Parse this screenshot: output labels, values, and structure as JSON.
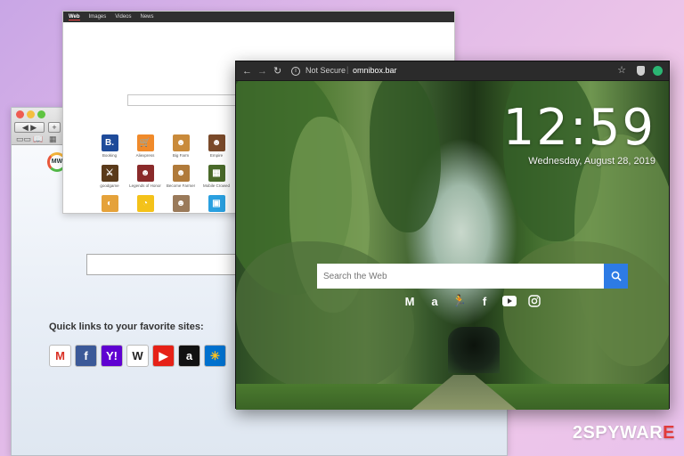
{
  "background_window_top": {
    "tabs": [
      "Web",
      "Images",
      "Videos",
      "News"
    ],
    "apps": [
      {
        "label": "Booking",
        "color": "#1e4b9a",
        "glyph": "B."
      },
      {
        "label": "Aliexpress",
        "color": "#f08a2a",
        "glyph": "🛒"
      },
      {
        "label": "Big Farm",
        "color": "#c98a3a",
        "glyph": "☻"
      },
      {
        "label": "Empire",
        "color": "#7a4a2a",
        "glyph": "☻"
      },
      {
        "label": "goodgame",
        "color": "#5a3a1a",
        "glyph": "⚔"
      },
      {
        "label": "Legends of Honor",
        "color": "#8a2a2a",
        "glyph": "☻"
      },
      {
        "label": "Become Farmer",
        "color": "#b07a3a",
        "glyph": "☻"
      },
      {
        "label": "Mobile Crowed",
        "color": "#4a6a2a",
        "glyph": "▦"
      },
      {
        "label": "",
        "color": "#e5a23a",
        "glyph": "◐"
      },
      {
        "label": "",
        "color": "#f4c21a",
        "glyph": "◔"
      },
      {
        "label": "",
        "color": "#9a7a5a",
        "glyph": "☻"
      },
      {
        "label": "",
        "color": "#2aa0e0",
        "glyph": "▣"
      }
    ]
  },
  "background_window_mac": {
    "logo_text": "MW",
    "quick_links_label": "Quick links to your favorite sites:",
    "quick_links": [
      {
        "name": "gmail",
        "glyph": "M",
        "color": "#ffffff",
        "fg": "#d93025"
      },
      {
        "name": "facebook",
        "glyph": "f",
        "color": "#3b5998",
        "fg": "#ffffff"
      },
      {
        "name": "yahoo",
        "glyph": "Y!",
        "color": "#5f01d1",
        "fg": "#ffffff"
      },
      {
        "name": "wikipedia",
        "glyph": "W",
        "color": "#ffffff",
        "fg": "#222222"
      },
      {
        "name": "youtube",
        "glyph": "▶",
        "color": "#e62117",
        "fg": "#ffffff"
      },
      {
        "name": "amazon",
        "glyph": "a",
        "color": "#111111",
        "fg": "#ffffff"
      },
      {
        "name": "walmart",
        "glyph": "✳",
        "color": "#0071ce",
        "fg": "#ffc220"
      }
    ]
  },
  "front_browser": {
    "address": {
      "security_label": "Not Secure",
      "separator": "|",
      "url": "omnibox.bar"
    },
    "clock": "12:59",
    "date": "Wednesday, August 28, 2019",
    "search": {
      "placeholder": "Search the Web"
    },
    "quick_links": [
      "gmail",
      "amazon",
      "fitness",
      "facebook",
      "youtube",
      "instagram"
    ],
    "colors": {
      "search_button": "#2d7be5",
      "extension_icon": "#2bb673"
    }
  },
  "watermark": {
    "prefix": "2SPYWAR",
    "suffix": "E"
  }
}
